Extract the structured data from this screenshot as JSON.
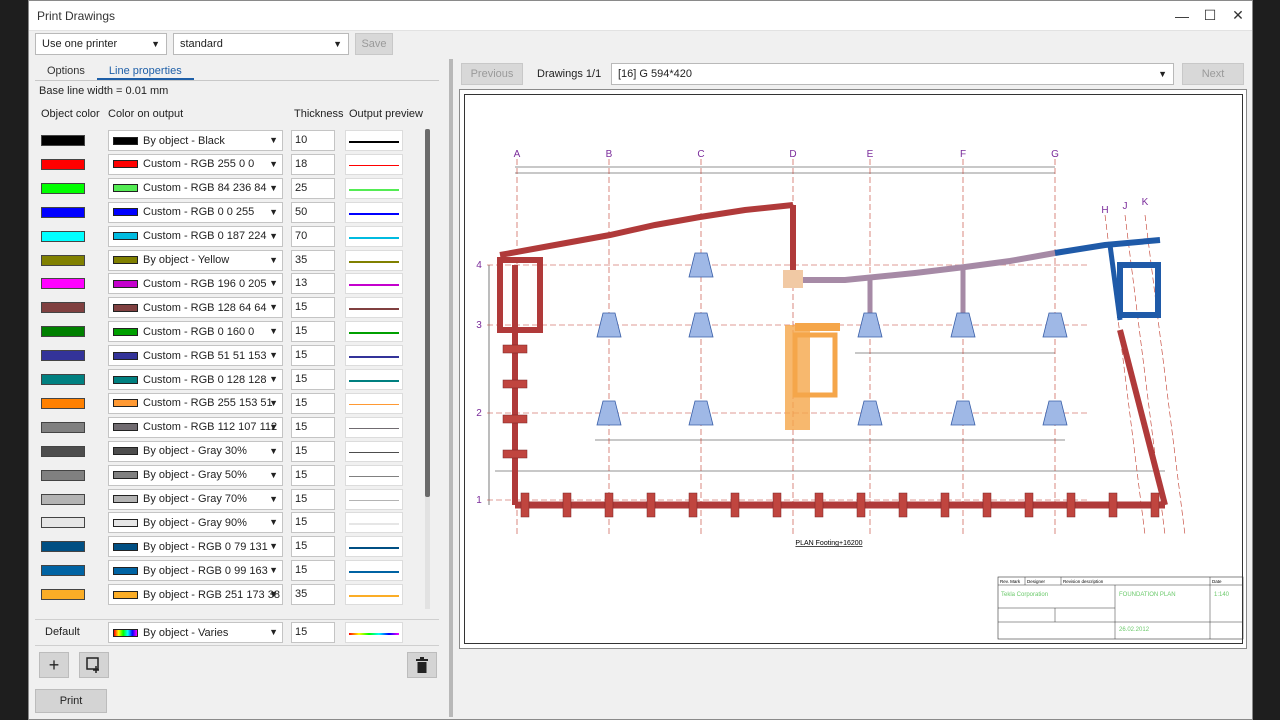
{
  "window": {
    "title": "Print Drawings"
  },
  "toolbar": {
    "printer_mode": "Use one printer",
    "settings": "standard",
    "save_label": "Save"
  },
  "tabs": [
    {
      "label": "Options"
    },
    {
      "label": "Line properties"
    }
  ],
  "baseline": {
    "label": "Base line width  =  0.01  mm"
  },
  "headers": {
    "object_color": "Object color",
    "color_on_output": "Color on output",
    "thickness": "Thickness",
    "output_preview": "Output preview"
  },
  "rows": [
    {
      "obj": "#000000",
      "out": "#000000",
      "label": "By object - Black",
      "thickness": "10"
    },
    {
      "obj": "#ff0000",
      "out": "#ff0000",
      "label": "Custom - RGB 255 0 0",
      "thickness": "18"
    },
    {
      "obj": "#00ff00",
      "out": "#54ec54",
      "label": "Custom - RGB 84 236 84",
      "thickness": "25"
    },
    {
      "obj": "#0000ff",
      "out": "#0000ff",
      "label": "Custom - RGB 0 0 255",
      "thickness": "50"
    },
    {
      "obj": "#00ffff",
      "out": "#00bbe0",
      "label": "Custom - RGB 0 187 224",
      "thickness": "70"
    },
    {
      "obj": "#808000",
      "out": "#808000",
      "label": "By object - Yellow",
      "thickness": "35"
    },
    {
      "obj": "#ff00ff",
      "out": "#c400cd",
      "label": "Custom - RGB 196 0 205",
      "thickness": "13"
    },
    {
      "obj": "#804040",
      "out": "#804040",
      "label": "Custom - RGB 128 64 64",
      "thickness": "15"
    },
    {
      "obj": "#008000",
      "out": "#00a000",
      "label": "Custom - RGB 0 160 0",
      "thickness": "15"
    },
    {
      "obj": "#333399",
      "out": "#333399",
      "label": "Custom - RGB 51 51 153",
      "thickness": "15"
    },
    {
      "obj": "#008080",
      "out": "#008080",
      "label": "Custom - RGB 0 128 128",
      "thickness": "15"
    },
    {
      "obj": "#ff8000",
      "out": "#ff9933",
      "label": "Custom - RGB 255 153 51",
      "thickness": "15"
    },
    {
      "obj": "#808080",
      "out": "#706b70",
      "label": "Custom - RGB 112 107 112",
      "thickness": "15"
    },
    {
      "obj": "#4d4d4d",
      "out": "#4d4d4d",
      "label": "By object - Gray 30%",
      "thickness": "15"
    },
    {
      "obj": "#808080",
      "out": "#808080",
      "label": "By object - Gray 50%",
      "thickness": "15"
    },
    {
      "obj": "#b3b3b3",
      "out": "#b3b3b3",
      "label": "By object - Gray 70%",
      "thickness": "15"
    },
    {
      "obj": "#e6e6e6",
      "out": "#e6e6e6",
      "label": "By object - Gray 90%",
      "thickness": "15"
    },
    {
      "obj": "#004f83",
      "out": "#004f83",
      "label": "By object - RGB 0 79 131",
      "thickness": "15"
    },
    {
      "obj": "#0063a3",
      "out": "#0063a3",
      "label": "By object - RGB 0 99 163",
      "thickness": "15"
    },
    {
      "obj": "#fbad26",
      "out": "#fbad26",
      "label": "By object - RGB 251 173 38",
      "thickness": "35"
    }
  ],
  "default_row": {
    "label": "Default",
    "color_label": "By object - Varies",
    "thickness": "15"
  },
  "footer": {
    "print_label": "Print"
  },
  "nav": {
    "previous_label": "Previous",
    "drawings_count": "Drawings 1/1",
    "drawing_selected": "[16]  G 594*420",
    "next_label": "Next"
  },
  "drawing": {
    "grid_columns": [
      "A",
      "B",
      "C",
      "D",
      "E",
      "F",
      "G",
      "H",
      "J",
      "K"
    ],
    "grid_rows": [
      "4",
      "3",
      "2",
      "1"
    ],
    "plan_title": "PLAN Footing+16200",
    "title_block": {
      "rev_mark": "Rev. Mark",
      "designer": "Designer",
      "rev_desc": "Revision description",
      "date": "Date",
      "company": "Tekla Corporation",
      "drawing_title": "FOUNDATION PLAN",
      "scale": "1:140",
      "issue_date": "26.02.2012"
    }
  }
}
